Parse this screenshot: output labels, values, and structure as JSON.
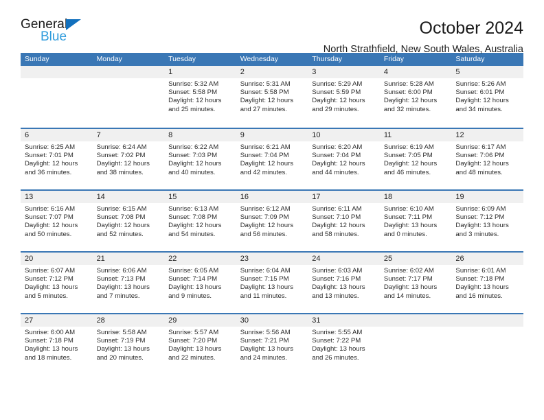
{
  "logo": {
    "word_top": "General",
    "word_bottom": "Blue",
    "triangle_color": "#1270bd",
    "blue_color": "#2e9bdc"
  },
  "header": {
    "title": "October 2024",
    "subtitle": "North Strathfield, New South Wales, Australia"
  },
  "theme": {
    "header_blue": "#3a77b5",
    "daynum_band": "#f0f0f0",
    "text": "#222222"
  },
  "weekdays": [
    "Sunday",
    "Monday",
    "Tuesday",
    "Wednesday",
    "Thursday",
    "Friday",
    "Saturday"
  ],
  "weeks": [
    [
      {
        "day": "",
        "lines": []
      },
      {
        "day": "",
        "lines": []
      },
      {
        "day": "1",
        "lines": [
          "Sunrise: 5:32 AM",
          "Sunset: 5:58 PM",
          "Daylight: 12 hours",
          "and 25 minutes."
        ]
      },
      {
        "day": "2",
        "lines": [
          "Sunrise: 5:31 AM",
          "Sunset: 5:58 PM",
          "Daylight: 12 hours",
          "and 27 minutes."
        ]
      },
      {
        "day": "3",
        "lines": [
          "Sunrise: 5:29 AM",
          "Sunset: 5:59 PM",
          "Daylight: 12 hours",
          "and 29 minutes."
        ]
      },
      {
        "day": "4",
        "lines": [
          "Sunrise: 5:28 AM",
          "Sunset: 6:00 PM",
          "Daylight: 12 hours",
          "and 32 minutes."
        ]
      },
      {
        "day": "5",
        "lines": [
          "Sunrise: 5:26 AM",
          "Sunset: 6:01 PM",
          "Daylight: 12 hours",
          "and 34 minutes."
        ]
      }
    ],
    [
      {
        "day": "6",
        "lines": [
          "Sunrise: 6:25 AM",
          "Sunset: 7:01 PM",
          "Daylight: 12 hours",
          "and 36 minutes."
        ]
      },
      {
        "day": "7",
        "lines": [
          "Sunrise: 6:24 AM",
          "Sunset: 7:02 PM",
          "Daylight: 12 hours",
          "and 38 minutes."
        ]
      },
      {
        "day": "8",
        "lines": [
          "Sunrise: 6:22 AM",
          "Sunset: 7:03 PM",
          "Daylight: 12 hours",
          "and 40 minutes."
        ]
      },
      {
        "day": "9",
        "lines": [
          "Sunrise: 6:21 AM",
          "Sunset: 7:04 PM",
          "Daylight: 12 hours",
          "and 42 minutes."
        ]
      },
      {
        "day": "10",
        "lines": [
          "Sunrise: 6:20 AM",
          "Sunset: 7:04 PM",
          "Daylight: 12 hours",
          "and 44 minutes."
        ]
      },
      {
        "day": "11",
        "lines": [
          "Sunrise: 6:19 AM",
          "Sunset: 7:05 PM",
          "Daylight: 12 hours",
          "and 46 minutes."
        ]
      },
      {
        "day": "12",
        "lines": [
          "Sunrise: 6:17 AM",
          "Sunset: 7:06 PM",
          "Daylight: 12 hours",
          "and 48 minutes."
        ]
      }
    ],
    [
      {
        "day": "13",
        "lines": [
          "Sunrise: 6:16 AM",
          "Sunset: 7:07 PM",
          "Daylight: 12 hours",
          "and 50 minutes."
        ]
      },
      {
        "day": "14",
        "lines": [
          "Sunrise: 6:15 AM",
          "Sunset: 7:08 PM",
          "Daylight: 12 hours",
          "and 52 minutes."
        ]
      },
      {
        "day": "15",
        "lines": [
          "Sunrise: 6:13 AM",
          "Sunset: 7:08 PM",
          "Daylight: 12 hours",
          "and 54 minutes."
        ]
      },
      {
        "day": "16",
        "lines": [
          "Sunrise: 6:12 AM",
          "Sunset: 7:09 PM",
          "Daylight: 12 hours",
          "and 56 minutes."
        ]
      },
      {
        "day": "17",
        "lines": [
          "Sunrise: 6:11 AM",
          "Sunset: 7:10 PM",
          "Daylight: 12 hours",
          "and 58 minutes."
        ]
      },
      {
        "day": "18",
        "lines": [
          "Sunrise: 6:10 AM",
          "Sunset: 7:11 PM",
          "Daylight: 13 hours",
          "and 0 minutes."
        ]
      },
      {
        "day": "19",
        "lines": [
          "Sunrise: 6:09 AM",
          "Sunset: 7:12 PM",
          "Daylight: 13 hours",
          "and 3 minutes."
        ]
      }
    ],
    [
      {
        "day": "20",
        "lines": [
          "Sunrise: 6:07 AM",
          "Sunset: 7:12 PM",
          "Daylight: 13 hours",
          "and 5 minutes."
        ]
      },
      {
        "day": "21",
        "lines": [
          "Sunrise: 6:06 AM",
          "Sunset: 7:13 PM",
          "Daylight: 13 hours",
          "and 7 minutes."
        ]
      },
      {
        "day": "22",
        "lines": [
          "Sunrise: 6:05 AM",
          "Sunset: 7:14 PM",
          "Daylight: 13 hours",
          "and 9 minutes."
        ]
      },
      {
        "day": "23",
        "lines": [
          "Sunrise: 6:04 AM",
          "Sunset: 7:15 PM",
          "Daylight: 13 hours",
          "and 11 minutes."
        ]
      },
      {
        "day": "24",
        "lines": [
          "Sunrise: 6:03 AM",
          "Sunset: 7:16 PM",
          "Daylight: 13 hours",
          "and 13 minutes."
        ]
      },
      {
        "day": "25",
        "lines": [
          "Sunrise: 6:02 AM",
          "Sunset: 7:17 PM",
          "Daylight: 13 hours",
          "and 14 minutes."
        ]
      },
      {
        "day": "26",
        "lines": [
          "Sunrise: 6:01 AM",
          "Sunset: 7:18 PM",
          "Daylight: 13 hours",
          "and 16 minutes."
        ]
      }
    ],
    [
      {
        "day": "27",
        "lines": [
          "Sunrise: 6:00 AM",
          "Sunset: 7:18 PM",
          "Daylight: 13 hours",
          "and 18 minutes."
        ]
      },
      {
        "day": "28",
        "lines": [
          "Sunrise: 5:58 AM",
          "Sunset: 7:19 PM",
          "Daylight: 13 hours",
          "and 20 minutes."
        ]
      },
      {
        "day": "29",
        "lines": [
          "Sunrise: 5:57 AM",
          "Sunset: 7:20 PM",
          "Daylight: 13 hours",
          "and 22 minutes."
        ]
      },
      {
        "day": "30",
        "lines": [
          "Sunrise: 5:56 AM",
          "Sunset: 7:21 PM",
          "Daylight: 13 hours",
          "and 24 minutes."
        ]
      },
      {
        "day": "31",
        "lines": [
          "Sunrise: 5:55 AM",
          "Sunset: 7:22 PM",
          "Daylight: 13 hours",
          "and 26 minutes."
        ]
      },
      {
        "day": "",
        "lines": []
      },
      {
        "day": "",
        "lines": []
      }
    ]
  ]
}
